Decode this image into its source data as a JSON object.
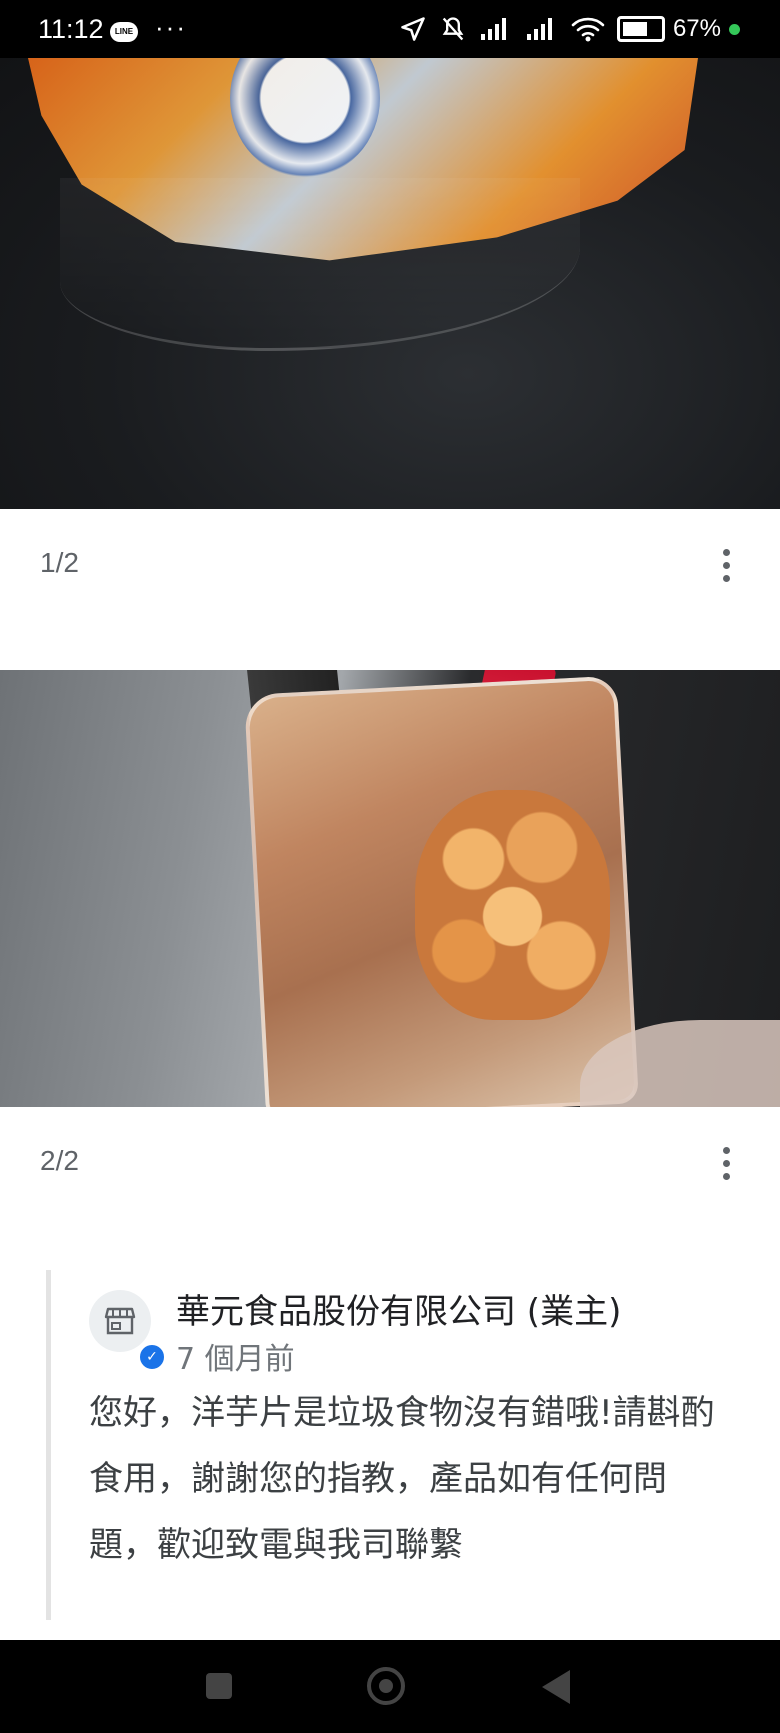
{
  "status_bar": {
    "time": "11:12",
    "line_badge": "LINE",
    "more": "···",
    "battery": "67%"
  },
  "gallery": [
    {
      "counter": "1/2"
    },
    {
      "counter": "2/2"
    }
  ],
  "reply": {
    "owner_name": "華元食品股份有限公司 (業主)",
    "time": "7 個月前",
    "text": "您好，洋芋片是垃圾食物沒有錯哦!請斟酌食用，謝謝您的指教，產品如有任何問題，歡迎致電與我司聯繫"
  },
  "colors": {
    "verified_badge": "#1a73e8",
    "status_dot": "#34c759"
  },
  "icons": [
    "navigation-arrow-icon",
    "mute-icon",
    "signal-icon",
    "wifi-icon",
    "battery-icon",
    "more-vert-icon",
    "store-icon",
    "verified-icon",
    "recents-icon",
    "home-icon",
    "back-icon"
  ]
}
